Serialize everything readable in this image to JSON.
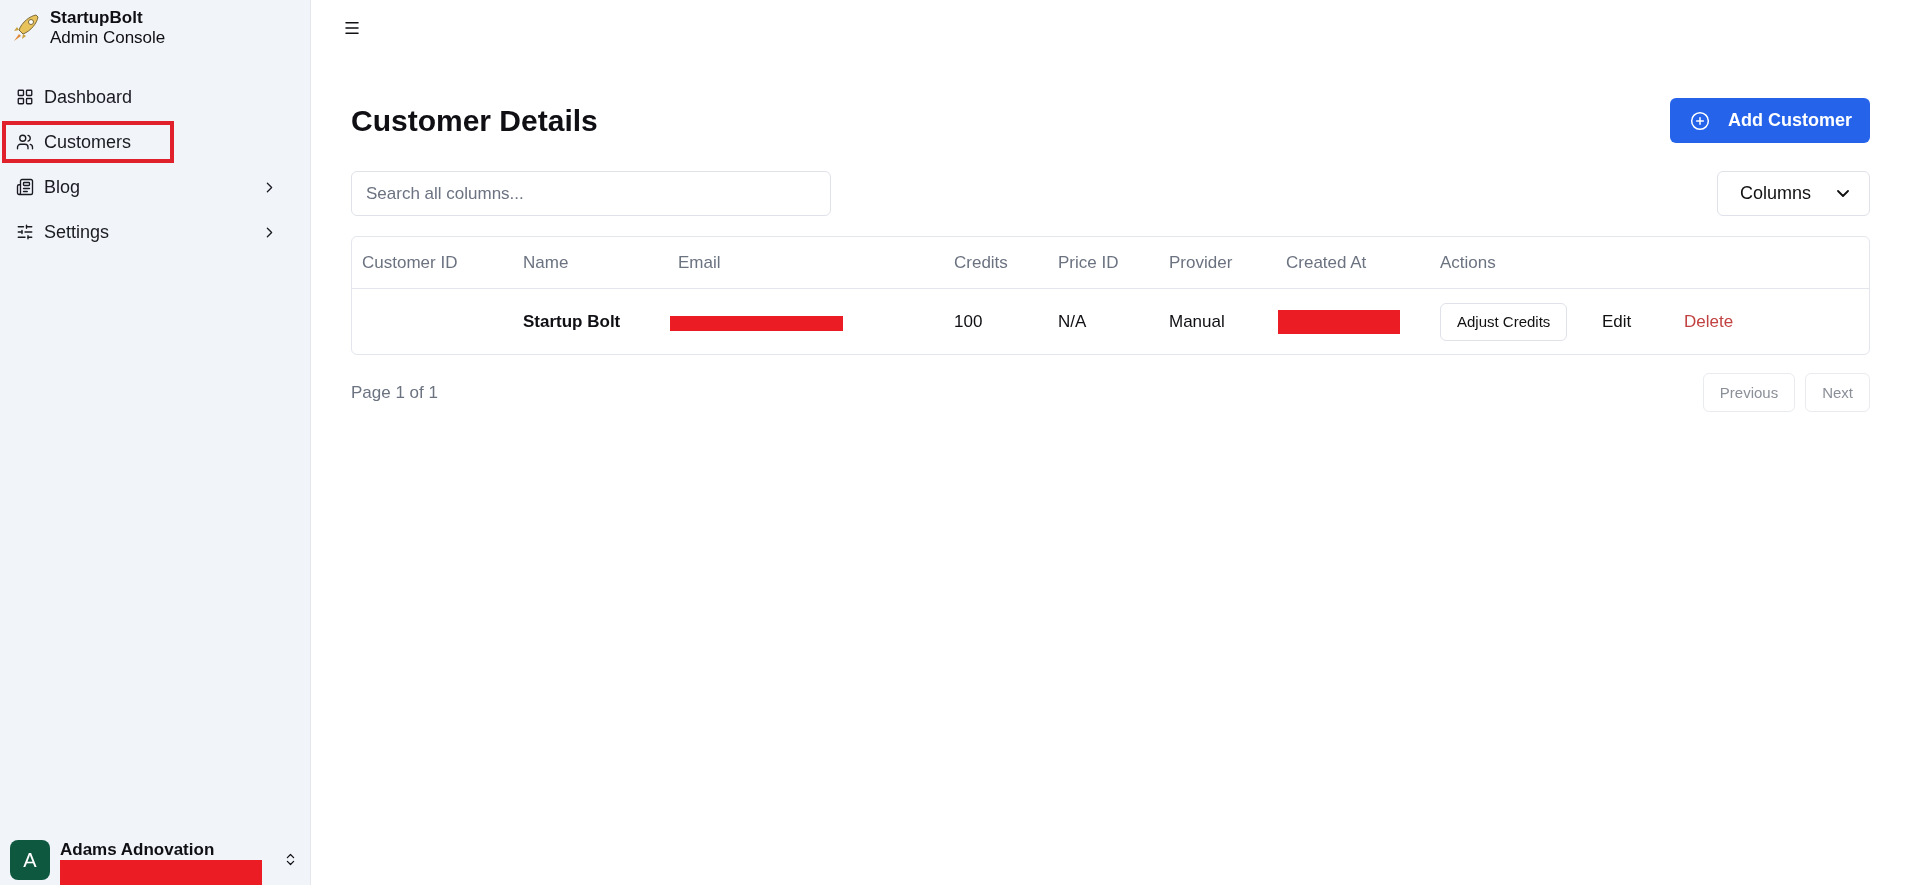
{
  "sidebar": {
    "brand": {
      "name": "StartupBolt",
      "subtitle": "Admin Console"
    },
    "items": [
      {
        "label": "Dashboard",
        "kind": "dashboard",
        "has_submenu": false,
        "highlighted": false
      },
      {
        "label": "Customers",
        "kind": "users",
        "has_submenu": false,
        "highlighted": true
      },
      {
        "label": "Blog",
        "kind": "newspaper",
        "has_submenu": true,
        "highlighted": false
      },
      {
        "label": "Settings",
        "kind": "sliders",
        "has_submenu": true,
        "highlighted": false
      }
    ],
    "user": {
      "initial": "A",
      "name": "Adams Adnovation",
      "redacted": true
    }
  },
  "header": {
    "title": "Customer Details",
    "add_button": "Add Customer"
  },
  "search": {
    "placeholder": "Search all columns..."
  },
  "columns_button": "Columns",
  "table": {
    "columns": [
      "Customer ID",
      "Name",
      "Email",
      "Credits",
      "Price ID",
      "Provider",
      "Created At",
      "Actions"
    ],
    "rows": [
      {
        "customer_id": "",
        "name": "Startup Bolt",
        "email_redacted": true,
        "credits": "100",
        "price_id": "N/A",
        "provider": "Manual",
        "created_at_redacted": true,
        "actions": {
          "adjust": "Adjust Credits",
          "edit": "Edit",
          "delete": "Delete"
        }
      }
    ]
  },
  "pagination": {
    "label": "Page 1 of 1",
    "previous": {
      "label": "Previous",
      "disabled": true
    },
    "next": {
      "label": "Next",
      "disabled": true
    }
  }
}
